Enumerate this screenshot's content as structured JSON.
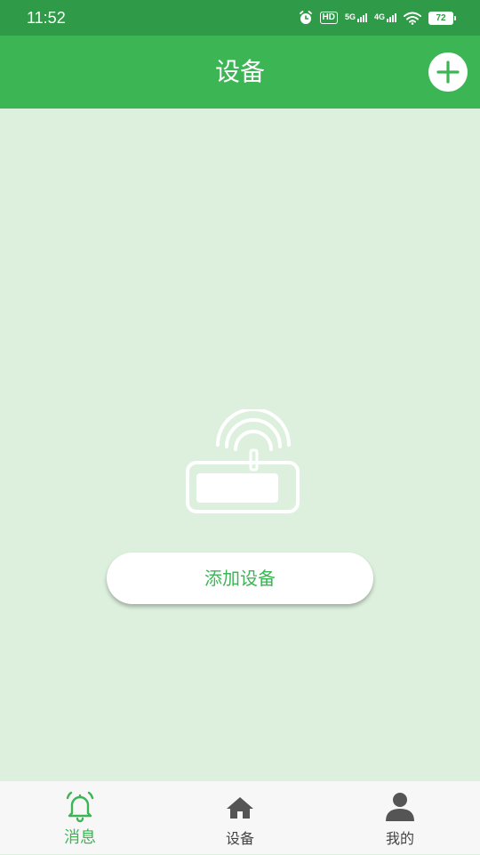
{
  "status_bar": {
    "time": "11:52",
    "hd_label": "HD",
    "network_1": "5G",
    "network_2": "4G",
    "battery": "72",
    "icons": [
      "alarm-icon",
      "hd-icon",
      "signal-5g-icon",
      "signal-4g-icon",
      "wifi-icon",
      "battery-icon"
    ]
  },
  "app_bar": {
    "title": "设备",
    "add_icon": "plus-icon"
  },
  "empty_state": {
    "illustration": "router-wifi-icon",
    "button_label": "添加设备"
  },
  "bottom_nav": {
    "items": [
      {
        "label": "消息",
        "icon": "bell-icon",
        "active": true
      },
      {
        "label": "设备",
        "icon": "home-icon",
        "active": false
      },
      {
        "label": "我的",
        "icon": "user-icon",
        "active": false
      }
    ]
  },
  "colors": {
    "status_bar": "#2f9a47",
    "app_bar": "#3cb554",
    "background": "#ddf0dd",
    "accent": "#3cb554",
    "nav_background": "#f7f7f7",
    "inactive": "#444444"
  }
}
